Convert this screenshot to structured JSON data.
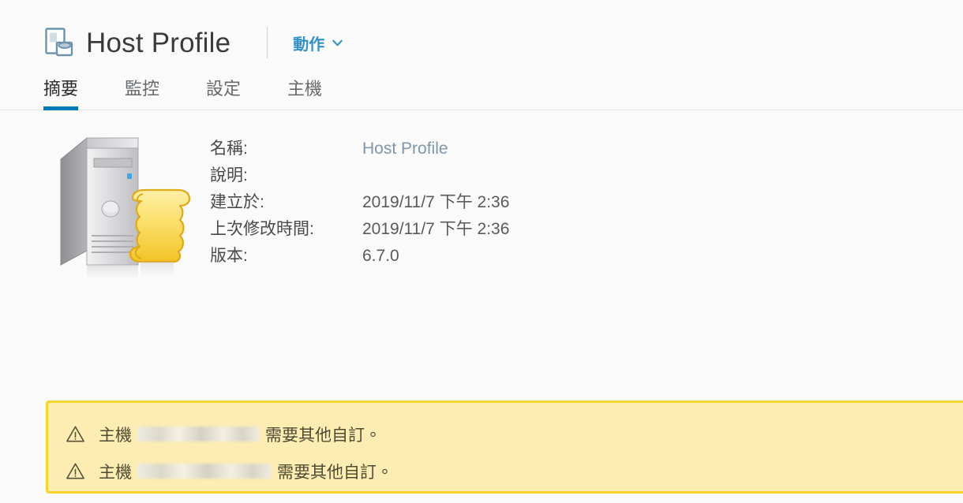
{
  "header": {
    "icon": "host-profile-icon",
    "title": "Host Profile",
    "actions_label": "動作",
    "actions_chevron": "chevron-down-icon"
  },
  "tabs": [
    {
      "label": "摘要",
      "active": true
    },
    {
      "label": "監控",
      "active": false
    },
    {
      "label": "設定",
      "active": false
    },
    {
      "label": "主機",
      "active": false
    }
  ],
  "summary": {
    "thumbnail_icon": "server-with-scroll-icon",
    "details": [
      {
        "label": "名稱:",
        "value": "Host Profile",
        "link": true
      },
      {
        "label": "說明:",
        "value": "",
        "link": false
      },
      {
        "label": "建立於:",
        "value": "2019/11/7 下午 2:36",
        "link": false
      },
      {
        "label": "上次修改時間:",
        "value": "2019/11/7 下午 2:36",
        "link": false
      },
      {
        "label": "版本:",
        "value": "6.7.0",
        "link": false
      }
    ]
  },
  "banner": {
    "icon": "warning-triangle-icon",
    "messages": [
      {
        "prefix": "主機",
        "redacted_width": 155,
        "suffix": "需要其他自訂。"
      },
      {
        "prefix": "主機",
        "redacted_width": 170,
        "suffix": "需要其他自訂。"
      }
    ]
  },
  "colors": {
    "page_background": "#fafafa",
    "accent_blue": "#0079b8",
    "link_blue": "#3390c8",
    "banner_background": "#fdedb2",
    "banner_border": "#f7d52e",
    "title_text": "#3b3b3b"
  }
}
